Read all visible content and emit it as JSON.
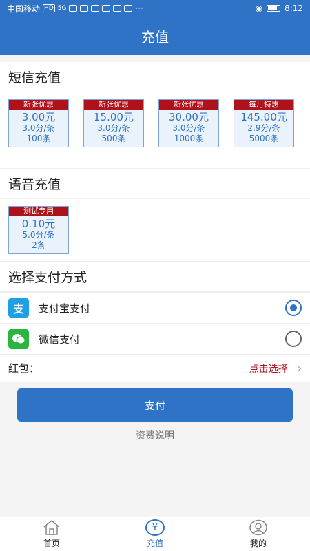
{
  "status": {
    "carrier": "中国移动",
    "hd": "HD",
    "net": "5G",
    "more": "···",
    "time": "8:12"
  },
  "appbar": {
    "title": "充值"
  },
  "sms": {
    "title": "短信充值",
    "packages": [
      {
        "tag": "新张优惠",
        "price": "3.00元",
        "rate": "3.0分/条",
        "count": "100条"
      },
      {
        "tag": "新张优惠",
        "price": "15.00元",
        "rate": "3.0分/条",
        "count": "500条"
      },
      {
        "tag": "新张优惠",
        "price": "30.00元",
        "rate": "3.0分/条",
        "count": "1000条"
      },
      {
        "tag": "每月特惠",
        "price": "145.00元",
        "rate": "2.9分/条",
        "count": "5000条"
      }
    ]
  },
  "voice": {
    "title": "语音充值",
    "packages": [
      {
        "tag": "测试专用",
        "price": "0.10元",
        "rate": "5.0分/条",
        "count": "2条"
      }
    ]
  },
  "payment": {
    "title": "选择支付方式",
    "methods": [
      {
        "label": "支付宝支付",
        "icon": "alipay-icon",
        "icon_color": "#1fa0e5",
        "selected": true
      },
      {
        "label": "微信支付",
        "icon": "wechat-icon",
        "icon_color": "#2bb540",
        "selected": false
      }
    ]
  },
  "hongbao": {
    "label": "红包：",
    "action": "点击选择",
    "chevron": "›"
  },
  "pay_button": {
    "label": "支付"
  },
  "fee_link": {
    "label": "资费说明"
  },
  "nav": {
    "items": [
      {
        "label": "首页",
        "icon": "home-icon",
        "glyph": "⌂",
        "active": false
      },
      {
        "label": "充值",
        "icon": "yen-icon",
        "glyph": "¥",
        "active": true
      },
      {
        "label": "我的",
        "icon": "user-icon",
        "glyph": "◯",
        "active": false
      }
    ]
  },
  "colors": {
    "primary": "#2f73c6",
    "tag_red": "#b0121c",
    "background": "#f4f4f4"
  }
}
